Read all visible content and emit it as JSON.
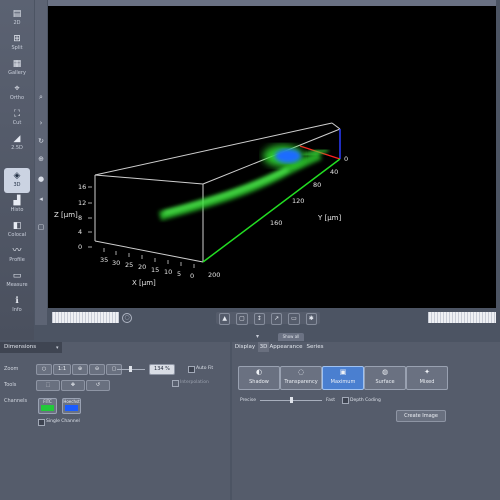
{
  "left_toolbar": {
    "items": [
      {
        "id": "2d",
        "label": "2D",
        "icon": "layers-icon",
        "glyph": "▤",
        "active": false
      },
      {
        "id": "split",
        "label": "Split",
        "icon": "split-view-icon",
        "glyph": "⊞",
        "active": false
      },
      {
        "id": "gallery",
        "label": "Gallery",
        "icon": "gallery-icon",
        "glyph": "▦",
        "active": false
      },
      {
        "id": "ortho",
        "label": "Ortho",
        "icon": "ortho-icon",
        "glyph": "⌖",
        "active": false
      },
      {
        "id": "cut",
        "label": "Cut",
        "icon": "cut-icon",
        "glyph": "⛶",
        "active": false
      },
      {
        "id": "2.5d",
        "label": "2.5D",
        "icon": "surface-icon",
        "glyph": "◢",
        "active": false
      },
      {
        "id": "3d",
        "label": "3D",
        "icon": "3d-view-icon",
        "glyph": "◈",
        "active": true
      },
      {
        "id": "histo",
        "label": "Histo",
        "icon": "histogram-icon",
        "glyph": "▟",
        "active": false
      },
      {
        "id": "colocal",
        "label": "Colocal",
        "icon": "colocalization-icon",
        "glyph": "◧",
        "active": false
      },
      {
        "id": "profile",
        "label": "Profile",
        "icon": "profile-icon",
        "glyph": "〰",
        "active": false
      },
      {
        "id": "measure",
        "label": "Measure",
        "icon": "measure-icon",
        "glyph": "▭",
        "active": false
      },
      {
        "id": "info",
        "label": "Info",
        "icon": "info-icon",
        "glyph": "ℹ",
        "active": false
      }
    ]
  },
  "viewport": {
    "z_axis_label": "Z [µm]",
    "z_ticks": [
      "16",
      "12",
      "8",
      "4",
      "0"
    ],
    "x_axis_label": "X [µm]",
    "x_ticks": [
      "35",
      "30",
      "25",
      "20",
      "15",
      "10",
      "5",
      "0"
    ],
    "y_axis_label": "Y [µm]",
    "y_ticks": [
      "0",
      "40",
      "80",
      "120",
      "160",
      "200"
    ],
    "colors": {
      "box": "#d9d9d9",
      "y_axis": "#22dd22",
      "x_axis": "#ff2020",
      "z_axis": "#2040ff",
      "signal": "#3be23b",
      "signal_core": "#1e6cff"
    }
  },
  "view_tools": {
    "show_all_label": "Show all"
  },
  "dimensions": {
    "title": "Dimensions",
    "zoom_label": "Zoom",
    "zoom_value": "134 %",
    "auto_fit_label": "Auto Fit",
    "interpolation_label": "Interpolation",
    "tools_label": "Tools",
    "channels_label": "Channels",
    "channels": [
      {
        "name": "FITC",
        "color": "#22c93a"
      },
      {
        "name": "Hoechst",
        "color": "#1b5cff"
      }
    ],
    "single_channel_label": "Single Channel"
  },
  "display": {
    "tabs": [
      {
        "label": "Display",
        "active": false
      },
      {
        "label": "3D",
        "active": true
      },
      {
        "label": "Appearance",
        "active": false
      },
      {
        "label": "Series",
        "active": false
      }
    ],
    "modes": [
      {
        "label": "Shadow",
        "icon": "shadow-icon",
        "glyph": "◐",
        "selected": false
      },
      {
        "label": "Transparency",
        "icon": "transparency-icon",
        "glyph": "◌",
        "selected": false
      },
      {
        "label": "Maximum",
        "icon": "maximum-icon",
        "glyph": "▣",
        "selected": true
      },
      {
        "label": "Surface",
        "icon": "surface-render-icon",
        "glyph": "◍",
        "selected": false
      },
      {
        "label": "Mixed",
        "icon": "mixed-icon",
        "glyph": "✦",
        "selected": false
      }
    ],
    "precise_label": "Precise",
    "fast_label": "Fast",
    "depth_coding_label": "Depth Coding",
    "create_image_label": "Create Image"
  }
}
